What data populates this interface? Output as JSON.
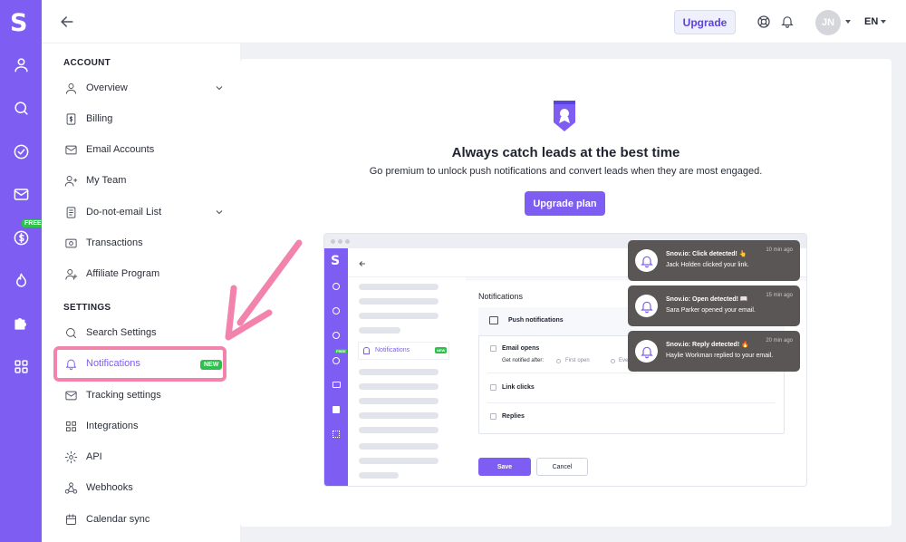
{
  "app": {
    "logo": "S",
    "free_badge": "FREE"
  },
  "topbar": {
    "upgrade_label": "Upgrade",
    "avatar_initials": "JN",
    "language": "EN"
  },
  "sidebar": {
    "account_title": "ACCOUNT",
    "account_items": [
      {
        "label": "Overview"
      },
      {
        "label": "Billing"
      },
      {
        "label": "Email Accounts"
      },
      {
        "label": "My Team"
      },
      {
        "label": "Do-not-email List"
      },
      {
        "label": "Transactions"
      },
      {
        "label": "Affiliate Program"
      }
    ],
    "settings_title": "SETTINGS",
    "settings_items": [
      {
        "label": "Search Settings"
      },
      {
        "label": "Notifications"
      },
      {
        "label": "Tracking settings"
      },
      {
        "label": "Integrations"
      },
      {
        "label": "API"
      },
      {
        "label": "Webhooks"
      },
      {
        "label": "Calendar sync"
      }
    ],
    "new_badge": "NEW"
  },
  "hero": {
    "title": "Always catch leads at the best time",
    "subtitle": "Go premium to unlock push notifications and convert leads when they are most engaged.",
    "button": "Upgrade plan"
  },
  "mock": {
    "logo": "S",
    "free_badge": "FREE",
    "nav_notifications": "Notifications",
    "nav_new": "NEW",
    "panel_title": "Notifications",
    "push_label": "Push notifications",
    "email_opens": "Email opens",
    "notified_after": "Get notified after:",
    "first_open": "First open",
    "every_open": "Eve",
    "link_clicks": "Link clicks",
    "replies": "Replies",
    "save": "Save",
    "cancel": "Cancel"
  },
  "toasts": [
    {
      "title": "Snov.io: Click detected! 👆",
      "text": "Jack Holden clicked your link.",
      "time": "10 min ago"
    },
    {
      "title": "Snov.io: Open detected! 📖",
      "text": "Sara Parker opened your email.",
      "time": "15 min ago"
    },
    {
      "title": "Snov.io: Reply detected! 🔥",
      "text": "Haylie Workman replied to your email.",
      "time": "20 min ago"
    }
  ],
  "colors": {
    "brand": "#7e5df2",
    "highlight": "#f283ad",
    "badge": "#2fbf4d",
    "toast": "#5a5656"
  }
}
